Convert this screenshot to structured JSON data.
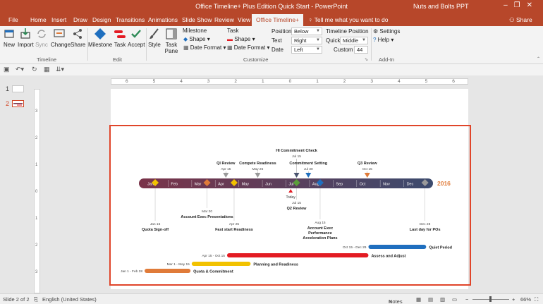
{
  "titlebar": {
    "title": "Office Timeline+ Plus Edition Quick Start - PowerPoint",
    "user": "Nuts and Bolts PPT"
  },
  "tabs": [
    "File",
    "Home",
    "Insert",
    "Draw",
    "Design",
    "Transitions",
    "Animations",
    "Slide Show",
    "Review",
    "View",
    "Office Timeline+"
  ],
  "active_tab": "Office Timeline+",
  "tell_me": "Tell me what you want to do",
  "share": "Share",
  "ribbon": {
    "new": "New",
    "import": "Import",
    "sync": "Sync",
    "change": "Change",
    "share": "Share",
    "group_timeline": "Timeline",
    "milestone": "Milestone",
    "task": "Task",
    "accept": "Accept",
    "group_edit": "Edit",
    "style": "Style",
    "task_pane_1": "Task",
    "task_pane_2": "Pane",
    "milestone_hdr": "Milestone",
    "ms_shape": "Shape",
    "ms_date": "Date Format",
    "task_hdr": "Task",
    "task_shape": "Shape",
    "task_date": "Date Format",
    "position_lbl": "Position",
    "position_val": "Below",
    "text_lbl": "Text",
    "text_val": "Right",
    "date_lbl": "Date",
    "date_val": "Left",
    "tl_position_lbl": "Timeline Position",
    "quick_lbl": "Quick",
    "quick_val": "Middle",
    "custom_lbl": "Custom",
    "custom_val": "44",
    "group_customize": "Customize",
    "settings": "Settings",
    "help": "Help",
    "group_addin": "Add-In"
  },
  "thumbs": {
    "n1": "1",
    "n2": "2"
  },
  "hruler_ticks": [
    "6",
    "5",
    "4",
    "3",
    "2",
    "1",
    "0",
    "1",
    "2",
    "3",
    "4",
    "5",
    "6"
  ],
  "vruler_ticks": [
    "3",
    "2",
    "1",
    "0",
    "1",
    "2",
    "3"
  ],
  "timeline": {
    "year": "2016",
    "months": [
      "Jan",
      "Feb",
      "Mar",
      "Apr",
      "May",
      "Jun",
      "Jul",
      "Aug",
      "Sep",
      "Oct",
      "Nov",
      "Dec"
    ],
    "today": "Today",
    "colors": {
      "bar_left": "#7a3349",
      "bar_right": "#3c4b6e",
      "orange": "#e07b39",
      "yellow": "#f2c200",
      "red": "#e31b23",
      "blue": "#1f6fbf",
      "year": "#e07b39"
    },
    "above": [
      {
        "title": "QI Review",
        "date": "Apr 15",
        "marker": "gray"
      },
      {
        "title": "Compete Readiness",
        "date": "May 25",
        "marker": "gray"
      },
      {
        "title": "HI Commitment Check",
        "date": "Jul 15",
        "marker": "dark"
      },
      {
        "title": "Commitment Setting",
        "date": "Jul 30",
        "marker": "blue"
      },
      {
        "title": "Q3 Review",
        "date": "Oct 15",
        "marker": "orange"
      }
    ],
    "below": [
      {
        "title": "Quota Sign-off",
        "date": "Jan 15",
        "color": "yellow"
      },
      {
        "title": "Account Exec Presentations",
        "date": "Mar 20",
        "color": "orange"
      },
      {
        "title": "Fast start Readiness",
        "date": "Apr 25",
        "color": "yellow"
      },
      {
        "title": "Q2 Review",
        "date": "Jul 15",
        "color": "green"
      },
      {
        "title_lines": [
          "Account Exec",
          "Performance",
          "Acceleration Plans"
        ],
        "date": "Aug 15",
        "color": "blue"
      },
      {
        "title": "Last day for POs",
        "date": "Dec 28",
        "color": "gray"
      }
    ],
    "tasks": [
      {
        "title": "Quiet Period",
        "dates": "Oct 15 - Dec 29",
        "color": "blue",
        "start_month": 9.5,
        "end_month": 11.95
      },
      {
        "title": "Assess and Adjust",
        "dates": "Apr 15 - Oct 15",
        "color": "red",
        "start_month": 3.5,
        "end_month": 9.5
      },
      {
        "title": "Planning and Readiness",
        "dates": "Mar 1 - May 15",
        "color": "yellow",
        "start_month": 2.0,
        "end_month": 4.5
      },
      {
        "title": "Quota & Commitment",
        "dates": "Jan 1 - Feb 28",
        "color": "orange",
        "start_month": 0.0,
        "end_month": 1.95
      }
    ]
  },
  "status": {
    "slide": "Slide 2 of 2",
    "lang": "English (United States)",
    "notes": "Notes",
    "zoom": "66%"
  }
}
